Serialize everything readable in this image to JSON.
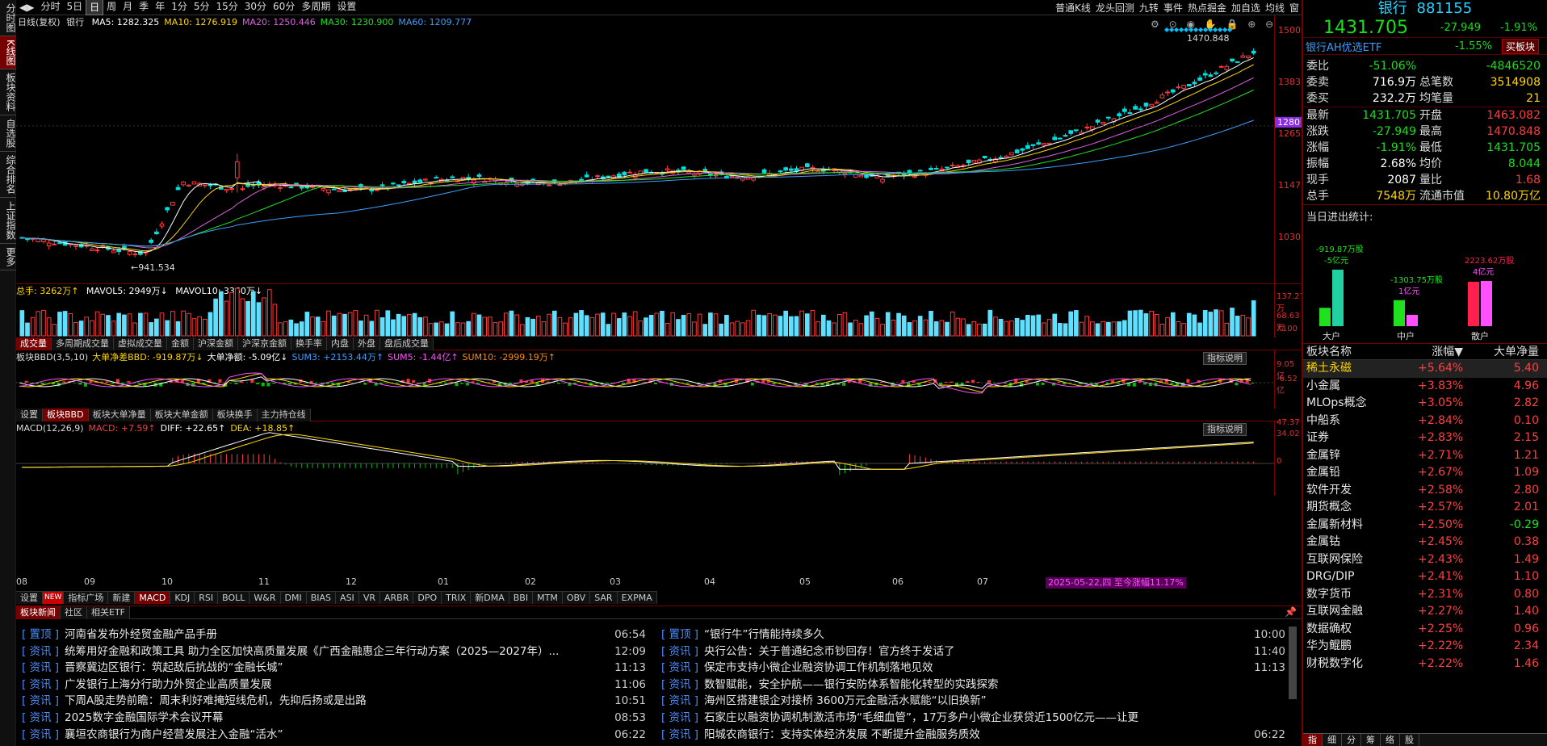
{
  "left_tabs": [
    {
      "label": "分时图",
      "active": false
    },
    {
      "label": "K线图",
      "active": true
    },
    {
      "label": "板块资料",
      "active": false
    },
    {
      "label": "自选股",
      "active": false
    },
    {
      "label": "综合排名",
      "active": false
    },
    {
      "label": "上证指数",
      "active": false
    },
    {
      "label": "更多",
      "active": false
    }
  ],
  "toolbar": {
    "periods": [
      "分时",
      "5日",
      "日",
      "周",
      "月",
      "季",
      "年",
      "1分",
      "5分",
      "15分",
      "30分",
      "60分",
      "多周期",
      "设置"
    ],
    "active_period": "日",
    "right_items": [
      "普通K线",
      "龙头回测",
      "九转",
      "事件",
      "热点掘金",
      "加自选",
      "均线",
      "窗"
    ]
  },
  "kline": {
    "title": "日线(复权)",
    "name": "银行",
    "ma": [
      {
        "label": "MA5: 1282.325",
        "color": "#ffffff"
      },
      {
        "label": "MA10: 1276.919",
        "color": "#ffd700"
      },
      {
        "label": "MA20: 1250.446",
        "color": "#e060e0"
      },
      {
        "label": "MA30: 1230.900",
        "color": "#20e020"
      },
      {
        "label": "MA60: 1209.777",
        "color": "#3aa0ff"
      }
    ],
    "axis": [
      "1500",
      "1383",
      "1265",
      "1147",
      "1030"
    ],
    "price_tag": "1280",
    "high_label": "1470.848",
    "low_label": "941.534",
    "months": [
      "08",
      "09",
      "10",
      "11",
      "12",
      "01",
      "02",
      "03",
      "04",
      "05",
      "06",
      "07"
    ],
    "event_label": "2025-05-22,四 至今涨幅11.17%"
  },
  "volume": {
    "legend_total": "总手: 3262万↑",
    "legend_ma5": "MAVOL5: 2949万↓",
    "legend_ma10": "MAVOL10: 3360万↓",
    "axis": [
      "137.27万",
      "68.63万",
      "X100"
    ],
    "tabs": [
      "成交量",
      "多周期成交量",
      "虚拟成交量",
      "金额",
      "沪深金额",
      "沪深京金额",
      "换手率",
      "内盘",
      "外盘",
      "盘后成交量"
    ],
    "active_tab": "成交量"
  },
  "bbd": {
    "legend": [
      "板块BBD(3,5,10)",
      "大单净差BBD: -919.87万↓",
      "大单净额: -5.09亿↓",
      "SUM3: +2153.44万↑",
      "SUM5: -1.44亿↑",
      "SUM10: -2999.19万↑"
    ],
    "help": "指标说明",
    "axis": [
      "9.05亿",
      "-6.52亿"
    ],
    "tabs": [
      "设置",
      "板块BBD",
      "板块大单净量",
      "板块大单金额",
      "板块换手",
      "主力持仓线"
    ],
    "active_tab": "板块BBD"
  },
  "macd": {
    "legend": [
      "MACD(12,26,9)",
      "MACD: +7.59↑",
      "DIFF: +22.65↑",
      "DEA: +18.85↑"
    ],
    "help": "指标说明",
    "axis": [
      "47.37",
      "34.02",
      "0"
    ],
    "tabs": [
      "设置",
      "NEW",
      "指标广场",
      "新建",
      "MACD",
      "KDJ",
      "RSI",
      "BOLL",
      "W&R",
      "DMI",
      "BIAS",
      "ASI",
      "VR",
      "ARBR",
      "DPO",
      "TRIX",
      "新DMA",
      "BBI",
      "MTM",
      "OBV",
      "SAR",
      "EXPMA"
    ],
    "active_tab": "MACD"
  },
  "news": {
    "tabs": [
      "板块新闻",
      "社区",
      "相关ETF"
    ],
    "active_tab": "板块新闻",
    "left": [
      {
        "tag": "置顶",
        "title": "河南省发布外经贸金融产品手册",
        "time": "06:54"
      },
      {
        "tag": "资讯",
        "title": "统筹用好金融和政策工具 助力全区加快高质量发展《广西金融惠企三年行动方案（2025—2027年）...",
        "time": "12:09"
      },
      {
        "tag": "资讯",
        "title": "晋察冀边区银行：筑起敌后抗战的“金融长城”",
        "time": "11:13"
      },
      {
        "tag": "资讯",
        "title": "广发银行上海分行助力外贸企业高质量发展",
        "time": "11:06"
      },
      {
        "tag": "资讯",
        "title": "下周A股走势前瞻：周末利好难掩短线危机，先抑后扬或是出路",
        "time": "10:51"
      },
      {
        "tag": "资讯",
        "title": "2025数字金融国际学术会议开幕",
        "time": "08:53"
      },
      {
        "tag": "资讯",
        "title": "襄垣农商银行为商户经营发展注入金融“活水”",
        "time": "06:22"
      }
    ],
    "right": [
      {
        "tag": "置顶",
        "title": "“银行牛”行情能持续多久",
        "time": "10:00"
      },
      {
        "tag": "资讯",
        "title": "央行公告：关于普通纪念币钞回存！官方终于发话了",
        "time": "11:40"
      },
      {
        "tag": "资讯",
        "title": "保定市支持小微企业融资协调工作机制落地见效",
        "time": "11:13"
      },
      {
        "tag": "资讯",
        "title": "数智赋能，安全护航——银行安防体系智能化转型的实践探索",
        "time": ""
      },
      {
        "tag": "资讯",
        "title": "海州区搭建银企对接桥 3600万元金融活水赋能“以旧换新”",
        "time": ""
      },
      {
        "tag": "资讯",
        "title": "石家庄以融资协调机制激活市场“毛细血管”，17万多户小微企业获贷近1500亿元——让更",
        "time": ""
      },
      {
        "tag": "资讯",
        "title": "阳城农商银行：支持实体经济发展 不断提升金融服务质效",
        "time": "06:22"
      }
    ]
  },
  "quote": {
    "name": "银行",
    "code": "881155",
    "price": "1431.705",
    "change": "-27.949",
    "pct": "-1.91%",
    "etf_name": "银行AH优选ETF",
    "etf_pct": "-1.55%",
    "buy_btn": "买板块",
    "rows1": [
      {
        "l": "委比",
        "v": "-51.06%",
        "vc": "grn",
        "l2": "",
        "v2": "-4846520",
        "v2c": "grn"
      },
      {
        "l": "委卖",
        "v": "716.9万",
        "vc": "wht",
        "l2": "总笔数",
        "v2": "3514908",
        "v2c": "yel"
      },
      {
        "l": "委买",
        "v": "232.2万",
        "vc": "wht",
        "l2": "均笔量",
        "v2": "21",
        "v2c": "yel"
      }
    ],
    "rows2": [
      {
        "l": "最新",
        "v": "1431.705",
        "vc": "grn",
        "l2": "开盘",
        "v2": "1463.082",
        "v2c": "red"
      },
      {
        "l": "涨跌",
        "v": "-27.949",
        "vc": "grn",
        "l2": "最高",
        "v2": "1470.848",
        "v2c": "red"
      },
      {
        "l": "涨幅",
        "v": "-1.91%",
        "vc": "grn",
        "l2": "最低",
        "v2": "1431.705",
        "v2c": "grn"
      },
      {
        "l": "振幅",
        "v": "2.68%",
        "vc": "wht",
        "l2": "均价",
        "v2": "8.044",
        "v2c": "grn"
      },
      {
        "l": "现手",
        "v": "2087",
        "vc": "wht",
        "l2": "量比",
        "v2": "1.68",
        "v2c": "red"
      },
      {
        "l": "总手",
        "v": "7548万",
        "vc": "yel",
        "l2": "流通市值",
        "v2": "10.80万亿",
        "v2c": "yel"
      }
    ]
  },
  "flow": {
    "title": "当日进出统计:",
    "groups": [
      {
        "label": "大户",
        "in_label": "-919.87万股",
        "out_label": "-5亿元",
        "in_val": -919.87,
        "out_val": -5
      },
      {
        "label": "中户",
        "in_label": "-1303.75万股",
        "out_label": "1亿元",
        "in_val": -1303.75,
        "out_val": 1
      },
      {
        "label": "散户",
        "in_label": "2223.62万股",
        "out_label": "4亿元",
        "in_val": 2223.62,
        "out_val": 4
      }
    ]
  },
  "plates": {
    "headers": [
      "板块名称",
      "涨幅▼",
      "大单净量"
    ],
    "rows": [
      {
        "name": "稀土永磁",
        "pct": "+5.64%",
        "flow": "5.40"
      },
      {
        "name": "小金属",
        "pct": "+3.83%",
        "flow": "4.96"
      },
      {
        "name": "MLOps概念",
        "pct": "+3.05%",
        "flow": "2.82"
      },
      {
        "name": "中船系",
        "pct": "+2.84%",
        "flow": "0.10"
      },
      {
        "name": "证券",
        "pct": "+2.83%",
        "flow": "2.15"
      },
      {
        "name": "金属锌",
        "pct": "+2.71%",
        "flow": "1.21"
      },
      {
        "name": "金属铅",
        "pct": "+2.67%",
        "flow": "1.09"
      },
      {
        "name": "软件开发",
        "pct": "+2.58%",
        "flow": "2.80"
      },
      {
        "name": "期货概念",
        "pct": "+2.57%",
        "flow": "2.01"
      },
      {
        "name": "金属新材料",
        "pct": "+2.50%",
        "flow": "-0.29"
      },
      {
        "name": "金属钴",
        "pct": "+2.45%",
        "flow": "0.38"
      },
      {
        "name": "互联网保险",
        "pct": "+2.43%",
        "flow": "1.49"
      },
      {
        "name": "DRG/DIP",
        "pct": "+2.41%",
        "flow": "1.10"
      },
      {
        "name": "数字货币",
        "pct": "+2.31%",
        "flow": "0.80"
      },
      {
        "name": "互联网金融",
        "pct": "+2.27%",
        "flow": "1.40"
      },
      {
        "name": "数据确权",
        "pct": "+2.25%",
        "flow": "0.96"
      },
      {
        "name": "华为鲲鹏",
        "pct": "+2.22%",
        "flow": "2.34"
      },
      {
        "name": "财税数字化",
        "pct": "+2.22%",
        "flow": "1.46"
      }
    ],
    "bottom_tabs": [
      "指",
      "细",
      "分",
      "筹",
      "络",
      "股"
    ]
  }
}
